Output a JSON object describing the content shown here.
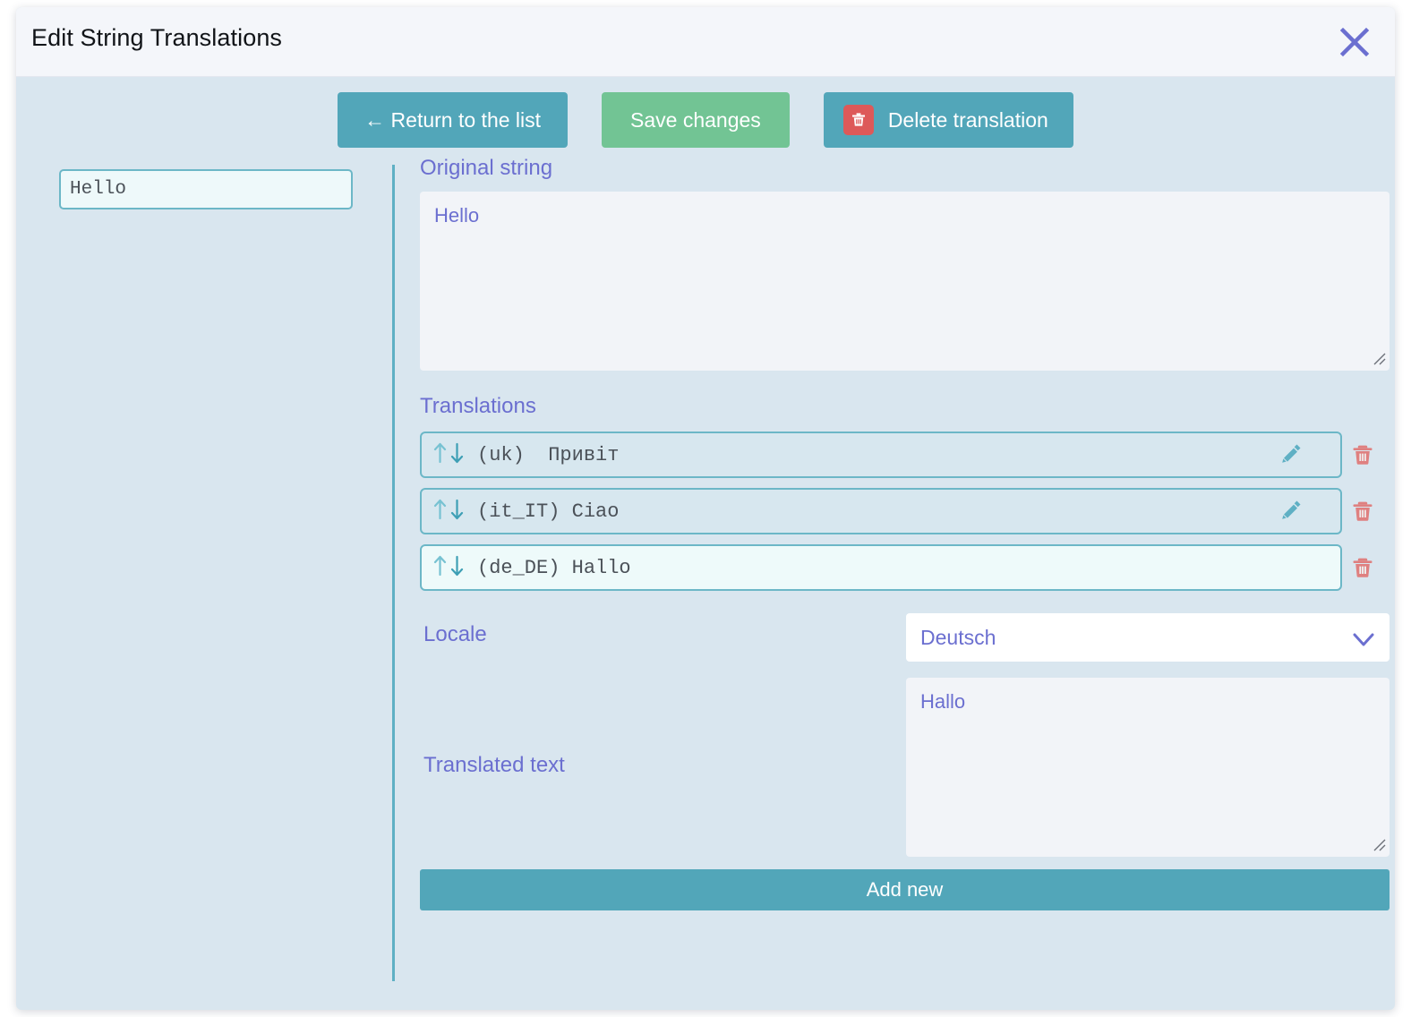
{
  "header": {
    "title": "Edit String Translations",
    "close_icon": "close-icon"
  },
  "toolbar": {
    "return_label": "← Return to the list",
    "save_label": "Save changes",
    "delete_label": "Delete translation",
    "delete_icon": "trash-icon",
    "teal_color": "#52a6b9",
    "green_color": "#72c494",
    "delete_badge_color": "#dd5959"
  },
  "left": {
    "key_value": "Hello",
    "key_placeholder": "Hello"
  },
  "original": {
    "label": "Original string",
    "value": "Hello"
  },
  "translations": {
    "label": "Translations",
    "rows": [
      {
        "locale": "(uk)",
        "text": "Привіт",
        "display": "(uk)  Привіт",
        "selected": false,
        "has_edit": true,
        "edit_icon": "pencil-icon",
        "delete_icon": "trash-icon"
      },
      {
        "locale": "(it_IT)",
        "text": "Ciao",
        "display": "(it_IT) Ciao",
        "selected": false,
        "has_edit": true,
        "edit_icon": "pencil-icon",
        "delete_icon": "trash-icon"
      },
      {
        "locale": "(de_DE)",
        "text": "Hallo",
        "display": "(de_DE) Hallo",
        "selected": true,
        "has_edit": false,
        "edit_icon": "",
        "delete_icon": "trash-icon"
      }
    ],
    "sort_up_icon": "arrow-up-icon",
    "sort_down_icon": "arrow-down-icon"
  },
  "locale": {
    "label": "Locale",
    "selected": "Deutsch",
    "chevron_icon": "chevron-down-icon"
  },
  "translated": {
    "label": "Translated text",
    "value": "Hallo"
  },
  "footer": {
    "add_new_label": "Add new"
  },
  "colors": {
    "panel_bg": "#d9e6ef",
    "header_bg": "#f4f6fa",
    "label_purple": "#6b6fd0",
    "teal_border": "#6cb7c7",
    "trash_red": "#df8080"
  }
}
